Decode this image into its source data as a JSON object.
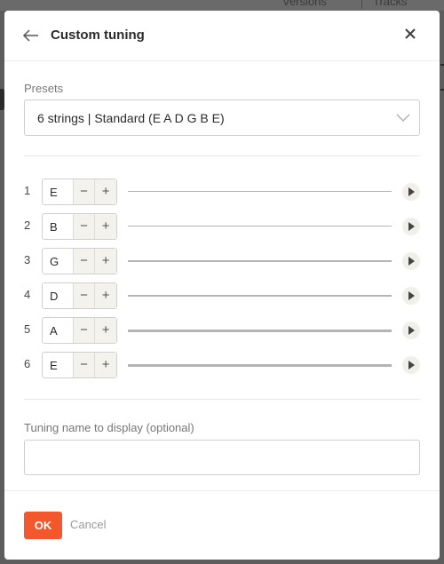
{
  "background": {
    "versions_label": "Versions",
    "tracks_label": "Tracks"
  },
  "dialog": {
    "title": "Custom tuning",
    "back_icon": "arrow-left-icon",
    "close_icon": "close-icon"
  },
  "presets": {
    "label": "Presets",
    "selected": "6 strings | Standard (E A D G B E)"
  },
  "strings": [
    {
      "number": "1",
      "note": "E"
    },
    {
      "number": "2",
      "note": "B"
    },
    {
      "number": "3",
      "note": "G"
    },
    {
      "number": "4",
      "note": "D"
    },
    {
      "number": "5",
      "note": "A"
    },
    {
      "number": "6",
      "note": "E"
    }
  ],
  "stepper": {
    "minus": "−",
    "plus": "+"
  },
  "tuning_name": {
    "label": "Tuning name to display (optional)",
    "value": "",
    "placeholder": ""
  },
  "footer": {
    "ok_label": "OK",
    "cancel_label": "Cancel"
  },
  "colors": {
    "accent": "#f2582c",
    "stepper_bg": "#f4f2ec"
  }
}
